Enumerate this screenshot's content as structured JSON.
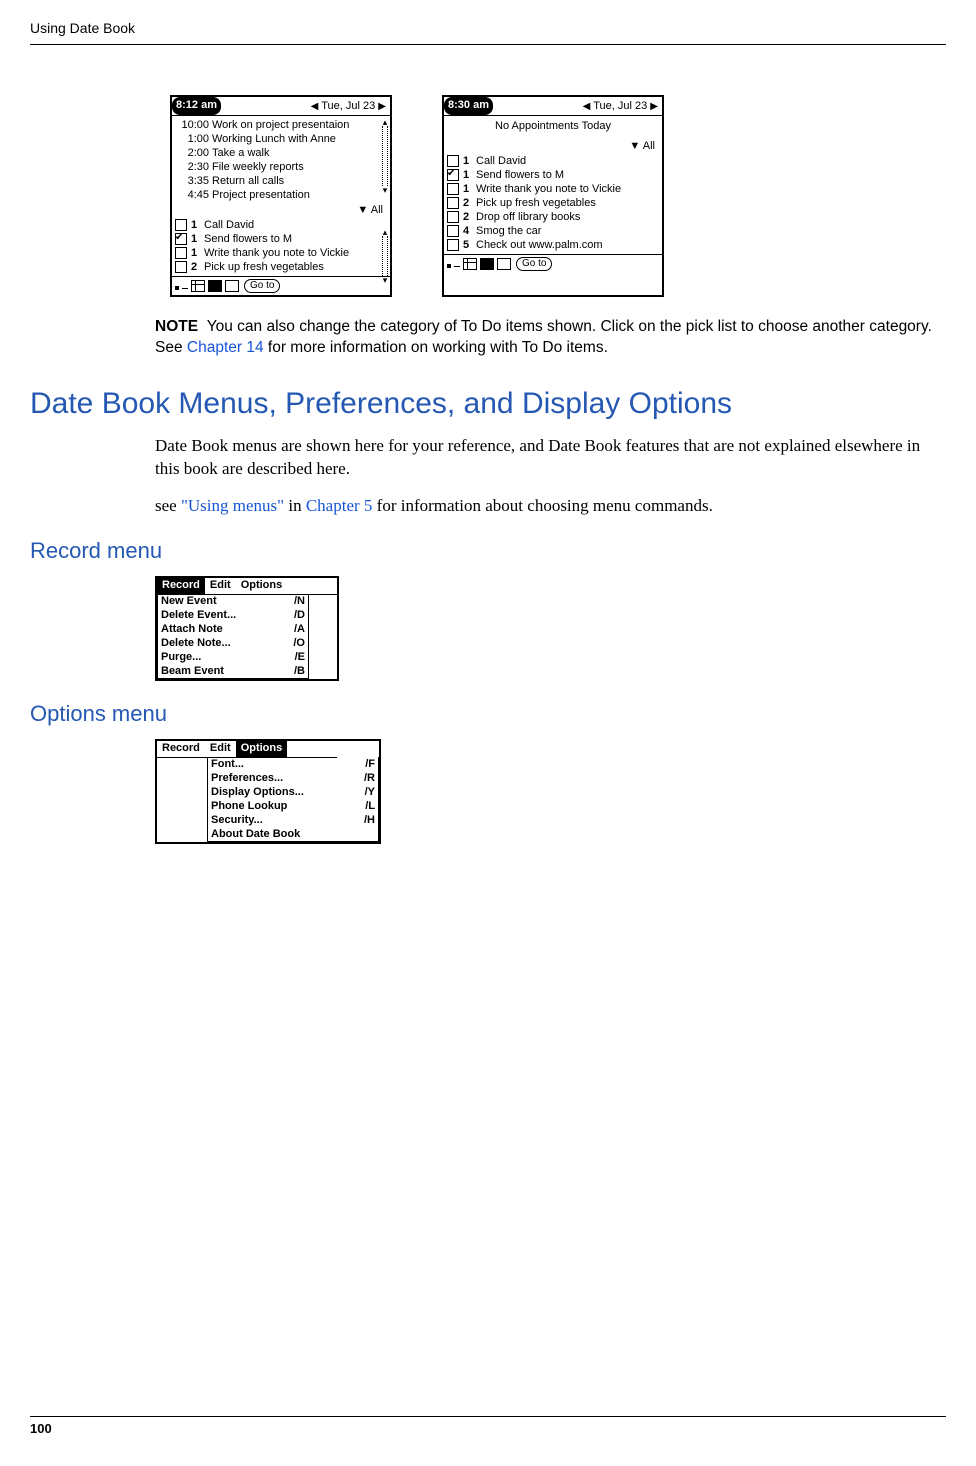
{
  "header_title": "Using Date Book",
  "page_number": "100",
  "screen_left": {
    "time": "8:12 am",
    "date": "Tue, Jul 23",
    "appointments": [
      {
        "time": "10:00",
        "text": "Work on project presentaion"
      },
      {
        "time": "1:00",
        "text": "Working Lunch with Anne"
      },
      {
        "time": "2:00",
        "text": "Take a walk"
      },
      {
        "time": "2:30",
        "text": "File weekly reports"
      },
      {
        "time": "3:35",
        "text": "Return all calls"
      },
      {
        "time": "4:45",
        "text": "Project presentation"
      }
    ],
    "all_label": "All",
    "todos": [
      {
        "checked": false,
        "priority": "1",
        "text": "Call David"
      },
      {
        "checked": true,
        "priority": "1",
        "text": "Send flowers to M"
      },
      {
        "checked": false,
        "priority": "1",
        "text": "Write thank you note to Vickie"
      },
      {
        "checked": false,
        "priority": "2",
        "text": "Pick up fresh vegetables"
      }
    ],
    "goto": "Go to"
  },
  "screen_right": {
    "time": "8:30 am",
    "date": "Tue, Jul 23",
    "no_appt": "No Appointments Today",
    "all_label": "All",
    "todos": [
      {
        "checked": false,
        "priority": "1",
        "text": "Call David"
      },
      {
        "checked": true,
        "priority": "1",
        "text": "Send flowers to M"
      },
      {
        "checked": false,
        "priority": "1",
        "text": "Write thank you note to Vickie"
      },
      {
        "checked": false,
        "priority": "2",
        "text": "Pick up fresh vegetables"
      },
      {
        "checked": false,
        "priority": "2",
        "text": "Drop off library books"
      },
      {
        "checked": false,
        "priority": "4",
        "text": "Smog the car"
      },
      {
        "checked": false,
        "priority": "5",
        "text": "Check out www.palm.com"
      }
    ],
    "goto": "Go to"
  },
  "note": {
    "label": "NOTE",
    "text_1": "You can also change the category of To Do items shown. Click on the pick list to choose another category. See ",
    "link": "Chapter 14",
    "text_2": " for more information on working with To Do items."
  },
  "h2": "Date Book Menus, Preferences, and Display Options",
  "para1": "Date Book menus are shown here for your reference, and Date Book features that are not explained elsewhere in this book are described here.",
  "para2_pre": "see ",
  "para2_link1": "\"Using menus\"",
  "para2_mid": " in ",
  "para2_link2": "Chapter 5",
  "para2_post": " for information about choosing menu commands.",
  "h3_record": "Record menu",
  "menubar_labels": {
    "record": "Record",
    "edit": "Edit",
    "options": "Options"
  },
  "record_menu": [
    {
      "label": "New Event",
      "sc": "/N"
    },
    {
      "label": "Delete Event...",
      "sc": "/D"
    },
    {
      "label": "Attach Note",
      "sc": "/A"
    },
    {
      "label": "Delete Note...",
      "sc": "/O"
    },
    {
      "label": "Purge...",
      "sc": "/E"
    },
    {
      "label": "Beam Event",
      "sc": "/B"
    }
  ],
  "h3_options": "Options menu",
  "options_menu": [
    {
      "label": "Font...",
      "sc": "/F"
    },
    {
      "label": "Preferences...",
      "sc": "/R"
    },
    {
      "label": "Display Options...",
      "sc": "/Y"
    },
    {
      "label": "Phone Lookup",
      "sc": "/L"
    },
    {
      "label": "Security...",
      "sc": "/H"
    },
    {
      "label": "About Date Book",
      "sc": ""
    }
  ]
}
